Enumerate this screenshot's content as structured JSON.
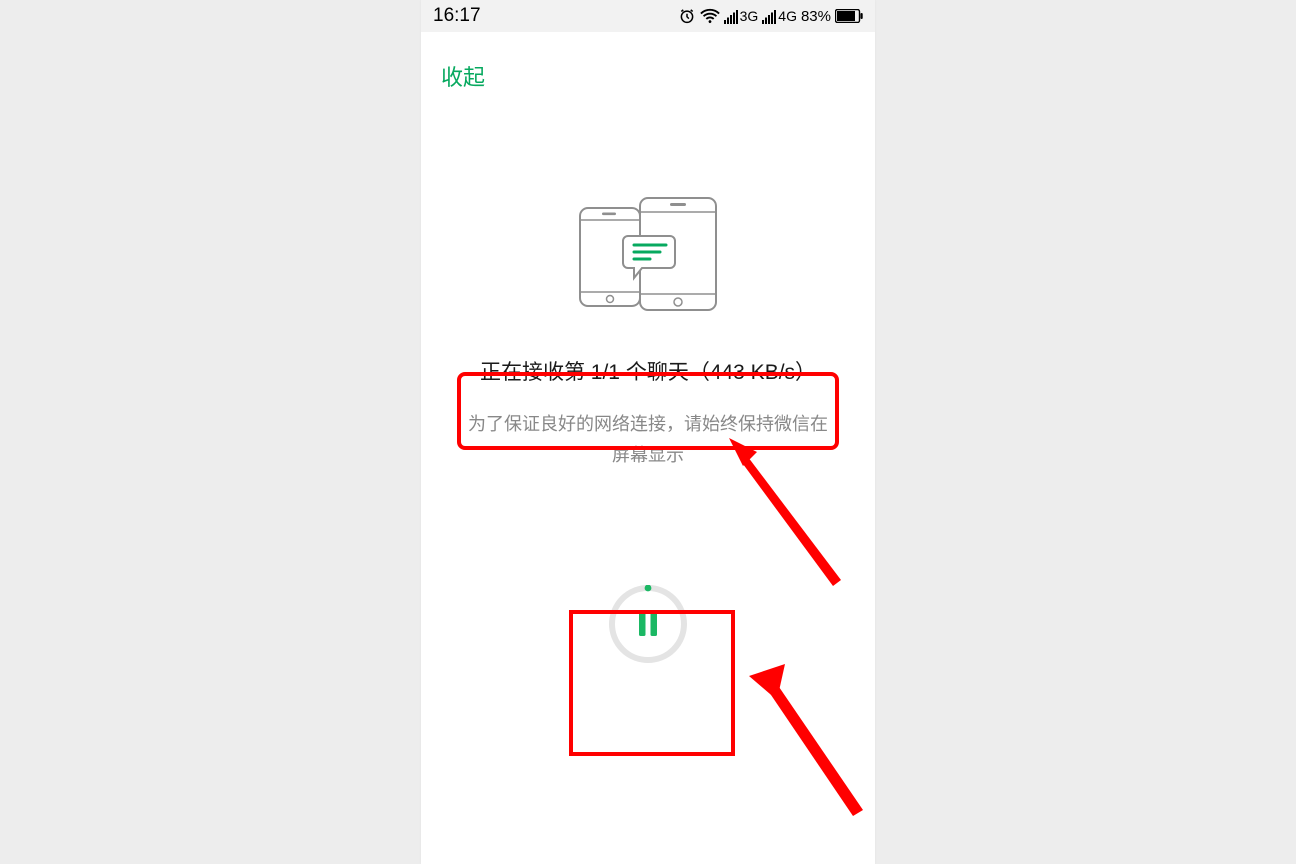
{
  "status_bar": {
    "time": "16:17",
    "net1_label": "3G",
    "net2_label": "4G",
    "battery_percent": "83%"
  },
  "header": {
    "collapse_label": "收起"
  },
  "progress": {
    "text": "正在接收第 1/1 个聊天（443 KB/s）"
  },
  "hint": {
    "text": "为了保证良好的网络连接，请始终保持微信在屏幕显示"
  },
  "icons": {
    "alarm": "alarm-icon",
    "wifi": "wifi-icon",
    "signal1": "signal-3g-icon",
    "signal2": "signal-4g-icon",
    "battery": "battery-icon",
    "phones": "chat-migration-illustration",
    "pause": "pause-icon"
  }
}
